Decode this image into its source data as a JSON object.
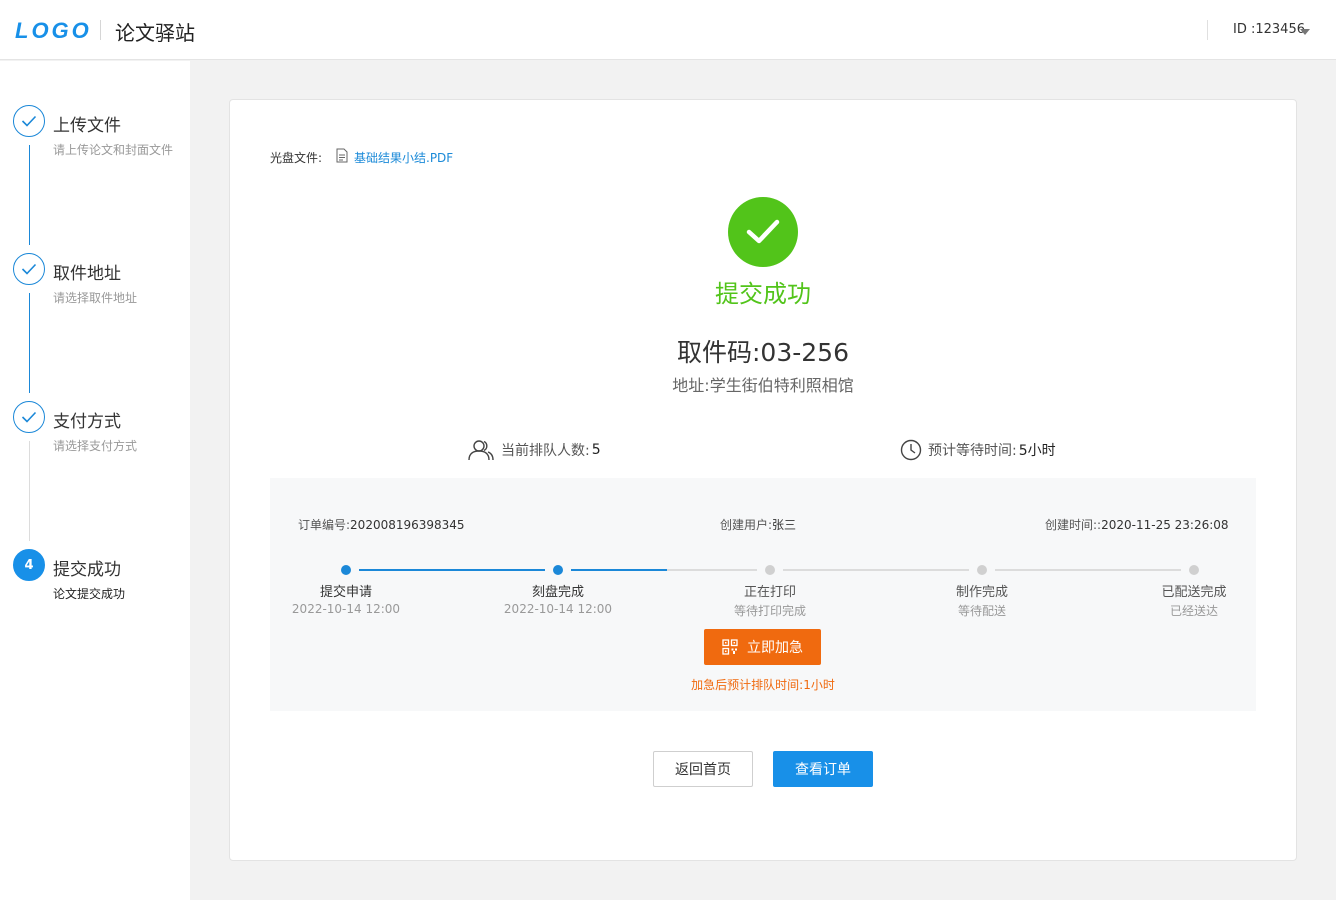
{
  "header": {
    "logo": "LOGO",
    "site_title": "论文驿站",
    "user_id": "ID :123456"
  },
  "sidebar": {
    "steps": [
      {
        "title": "上传文件",
        "subtitle": "请上传论文和封面文件",
        "status": "done"
      },
      {
        "title": "取件地址",
        "subtitle": "请选择取件地址",
        "status": "done"
      },
      {
        "title": "支付方式",
        "subtitle": "请选择支付方式",
        "status": "done"
      },
      {
        "title": "提交成功",
        "subtitle": "论文提交成功",
        "status": "active",
        "number": "4"
      }
    ]
  },
  "main": {
    "disc_file_label": "光盘文件:",
    "disc_file_name": "基础结果小结.PDF",
    "success_text": "提交成功",
    "pickup_code": "取件码:03-256",
    "address": "地址:学生街伯特利照相馆",
    "queue_label": "当前排队人数:",
    "queue_value": "5",
    "wait_label": "预计等待时间:",
    "wait_value": "5小时",
    "order": {
      "order_no_label": "订单编号:",
      "order_no": "202008196398345",
      "creator_label": "创建用户:",
      "creator": "张三",
      "created_label": "创建时间::",
      "created_time": "2020-11-25 23:26:08",
      "progress": [
        {
          "label": "提交申请",
          "sub": "2022-10-14 12:00",
          "done": true
        },
        {
          "label": "刻盘完成",
          "sub": "2022-10-14 12:00",
          "done": true
        },
        {
          "label": "正在打印",
          "sub": "等待打印完成",
          "done": false
        },
        {
          "label": "制作完成",
          "sub": "等待配送",
          "done": false
        },
        {
          "label": "已配送完成",
          "sub": "已经送达",
          "done": false
        }
      ],
      "rush_button": "立即加急",
      "rush_note": "加急后预计排队时间:1小时"
    },
    "btn_home": "返回首页",
    "btn_view_order": "查看订单"
  },
  "colors": {
    "accent": "#1890e8",
    "success": "#52c41a",
    "warning": "#f06a0f"
  }
}
